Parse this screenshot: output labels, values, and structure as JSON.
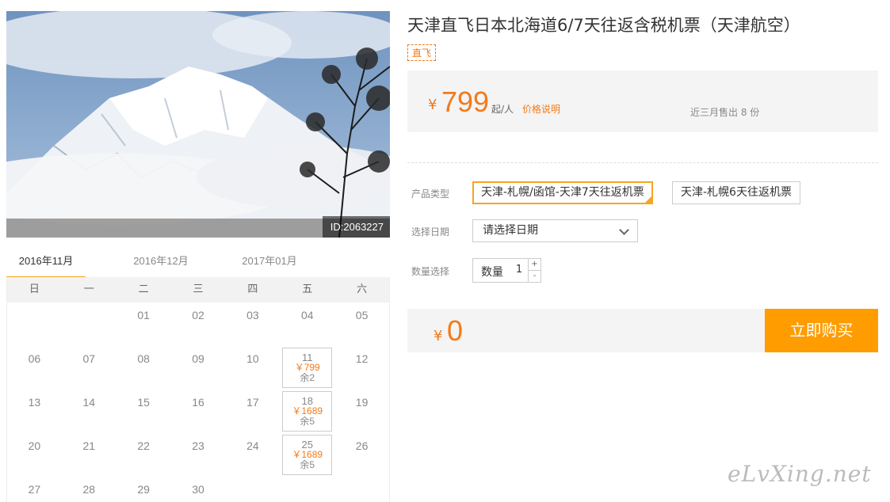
{
  "hero": {
    "id_badge": "ID:2063227"
  },
  "calendar": {
    "tabs": [
      "2016年11月",
      "2016年12月",
      "2017年01月"
    ],
    "active_tab": 0,
    "weekdays": [
      "日",
      "一",
      "二",
      "三",
      "四",
      "五",
      "六"
    ],
    "weeks": [
      [
        {
          "d": ""
        },
        {
          "d": ""
        },
        {
          "d": "01"
        },
        {
          "d": "02"
        },
        {
          "d": "03"
        },
        {
          "d": "04"
        },
        {
          "d": "05"
        }
      ],
      [
        {
          "d": "06"
        },
        {
          "d": "07"
        },
        {
          "d": "08"
        },
        {
          "d": "09"
        },
        {
          "d": "10"
        },
        {
          "d": "11",
          "price": "￥799",
          "remain": "余2"
        },
        {
          "d": "12"
        }
      ],
      [
        {
          "d": "13"
        },
        {
          "d": "14"
        },
        {
          "d": "15"
        },
        {
          "d": "16"
        },
        {
          "d": "17"
        },
        {
          "d": "18",
          "price": "￥1689",
          "remain": "余5"
        },
        {
          "d": "19"
        }
      ],
      [
        {
          "d": "20"
        },
        {
          "d": "21"
        },
        {
          "d": "22"
        },
        {
          "d": "23"
        },
        {
          "d": "24"
        },
        {
          "d": "25",
          "price": "￥1689",
          "remain": "余5"
        },
        {
          "d": "26"
        }
      ],
      [
        {
          "d": "27"
        },
        {
          "d": "28"
        },
        {
          "d": "29"
        },
        {
          "d": "30"
        },
        {
          "d": ""
        },
        {
          "d": ""
        },
        {
          "d": ""
        }
      ]
    ]
  },
  "product": {
    "title": "天津直飞日本北海道6/7天往返含税机票（天津航空）",
    "tag": "直飞",
    "price_currency": "¥",
    "price": "799",
    "price_unit": "起/人",
    "price_note": "价格说明",
    "sold": "近三月售出 8 份"
  },
  "form": {
    "type_label": "产品类型",
    "types": [
      "天津-札幌/函馆-天津7天往返机票",
      "天津-札幌6天往返机票"
    ],
    "selected_type": 0,
    "date_label": "选择日期",
    "date_placeholder": "请选择日期",
    "qty_section_label": "数量选择",
    "qty_label": "数量",
    "qty_value": "1",
    "plus": "+",
    "minus": "-"
  },
  "total": {
    "currency": "¥",
    "amount": "0",
    "buy_label": "立即购买"
  },
  "watermark": "eLvXing.net",
  "colors": {
    "accent": "#f27a1a",
    "button": "#ff9c00",
    "selected_border": "#f5a623"
  }
}
